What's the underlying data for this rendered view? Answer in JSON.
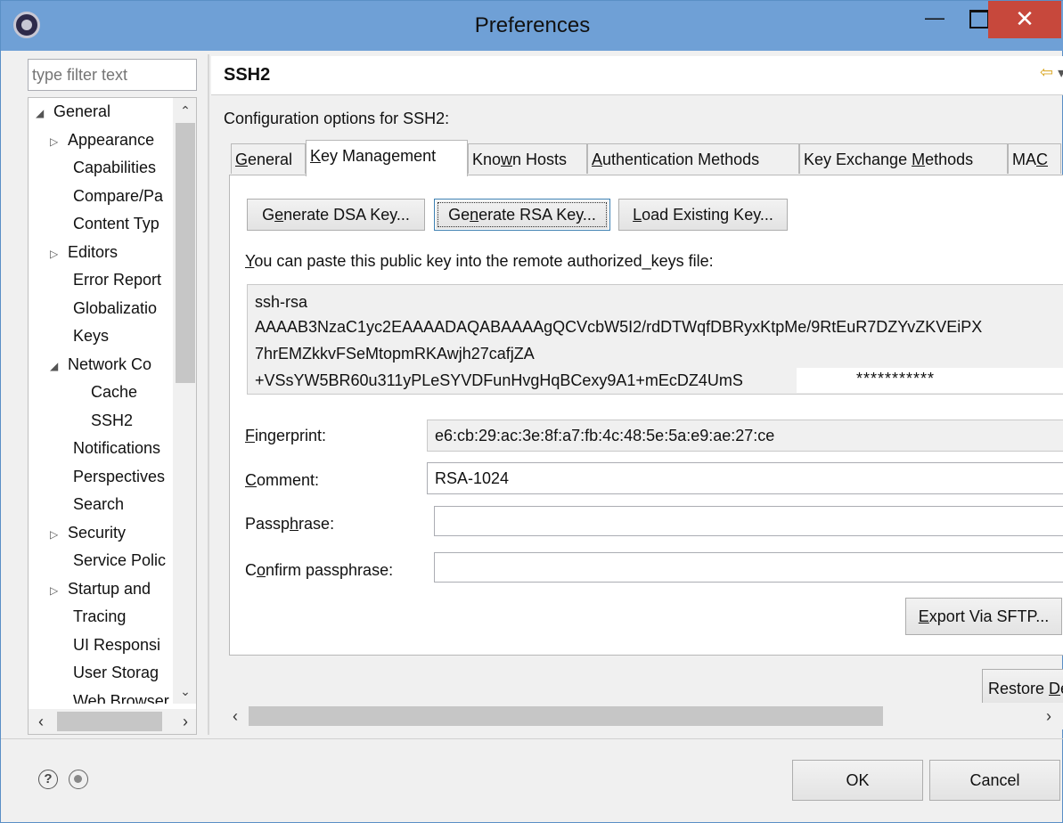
{
  "window": {
    "title": "Preferences",
    "minimize_glyph": "—",
    "close_glyph": "✕"
  },
  "sidebar": {
    "filter_placeholder": "type filter text",
    "items": [
      {
        "label": "General",
        "arrow": "◢",
        "indent": 0
      },
      {
        "label": "Appearance",
        "arrow": "▷",
        "indent": 1
      },
      {
        "label": "Capabilities",
        "arrow": "",
        "indent": 1
      },
      {
        "label": "Compare/Pa",
        "arrow": "",
        "indent": 1
      },
      {
        "label": "Content Typ",
        "arrow": "",
        "indent": 1
      },
      {
        "label": "Editors",
        "arrow": "▷",
        "indent": 1
      },
      {
        "label": "Error Report",
        "arrow": "",
        "indent": 1
      },
      {
        "label": "Globalizatio",
        "arrow": "",
        "indent": 1
      },
      {
        "label": "Keys",
        "arrow": "",
        "indent": 1
      },
      {
        "label": "Network Co",
        "arrow": "◢",
        "indent": 1
      },
      {
        "label": "Cache",
        "arrow": "",
        "indent": 2
      },
      {
        "label": "SSH2",
        "arrow": "",
        "indent": 2
      },
      {
        "label": "Notifications",
        "arrow": "",
        "indent": 1
      },
      {
        "label": "Perspectives",
        "arrow": "",
        "indent": 1
      },
      {
        "label": "Search",
        "arrow": "",
        "indent": 1
      },
      {
        "label": "Security",
        "arrow": "▷",
        "indent": 1
      },
      {
        "label": "Service Polic",
        "arrow": "",
        "indent": 1
      },
      {
        "label": "Startup and",
        "arrow": "▷",
        "indent": 1
      },
      {
        "label": "Tracing",
        "arrow": "",
        "indent": 1
      },
      {
        "label": "UI Responsi",
        "arrow": "",
        "indent": 1
      },
      {
        "label": "User Storag",
        "arrow": "",
        "indent": 1
      },
      {
        "label": "Web Browser",
        "arrow": "",
        "indent": 1
      }
    ]
  },
  "page": {
    "title": "SSH2",
    "config_label": "Configuration options for SSH2:",
    "tabs": [
      {
        "pre": "",
        "key": "G",
        "post": "eneral"
      },
      {
        "pre": "",
        "key": "K",
        "post": "ey Management"
      },
      {
        "pre": "Kno",
        "key": "w",
        "post": "n Hosts"
      },
      {
        "pre": "",
        "key": "A",
        "post": "uthentication Methods"
      },
      {
        "pre": "Key Exchange ",
        "key": "M",
        "post": "ethods"
      },
      {
        "pre": "MA",
        "key": "C",
        "post": ""
      }
    ],
    "buttons": {
      "gen_dsa": {
        "pre": "G",
        "key": "e",
        "post": "nerate DSA Key..."
      },
      "gen_rsa": {
        "pre": "Ge",
        "key": "n",
        "post": "erate RSA Key..."
      },
      "load": {
        "pre": "",
        "key": "L",
        "post": "oad Existing Key..."
      }
    },
    "paste_label": {
      "pre": "",
      "key": "Y",
      "post": "ou can paste this public key into the remote authorized_keys file:"
    },
    "public_key": {
      "line1": "ssh-rsa",
      "line2": "AAAAB3NzaC1yc2EAAAADAQABAAAAgQCVcbW5I2/rdDTWqfDBRyxKtpMe/9RtEuR7DZYvZKVEiPX",
      "line3": "7hrEMZkkvFSeMtopmRKAwjh27cafjZA",
      "line4": "+VSsYW5BR60u311yPLeSYVDFunHvgHqBCexy9A1+mEcDZ4UmS",
      "mask": "***********"
    },
    "fields": {
      "fingerprint": {
        "label_pre": "",
        "label_key": "F",
        "label_post": "ingerprint:",
        "value": "e6:cb:29:ac:3e:8f:a7:fb:4c:48:5e:5a:e9:ae:27:ce"
      },
      "comment": {
        "label_pre": "",
        "label_key": "C",
        "label_post": "omment:",
        "value": "RSA-1024"
      },
      "passphrase": {
        "label_pre": "Passp",
        "label_key": "h",
        "label_post": "rase:",
        "value": ""
      },
      "confirm": {
        "label_pre": "C",
        "label_key": "o",
        "label_post": "nfirm passphrase:",
        "value": ""
      }
    },
    "export": {
      "pre": "",
      "key": "E",
      "post": "xport Via SFTP..."
    },
    "restore": {
      "pre": "Restore ",
      "key": "D",
      "post": "efaults"
    }
  },
  "footer": {
    "ok": "OK",
    "cancel": "Cancel"
  }
}
